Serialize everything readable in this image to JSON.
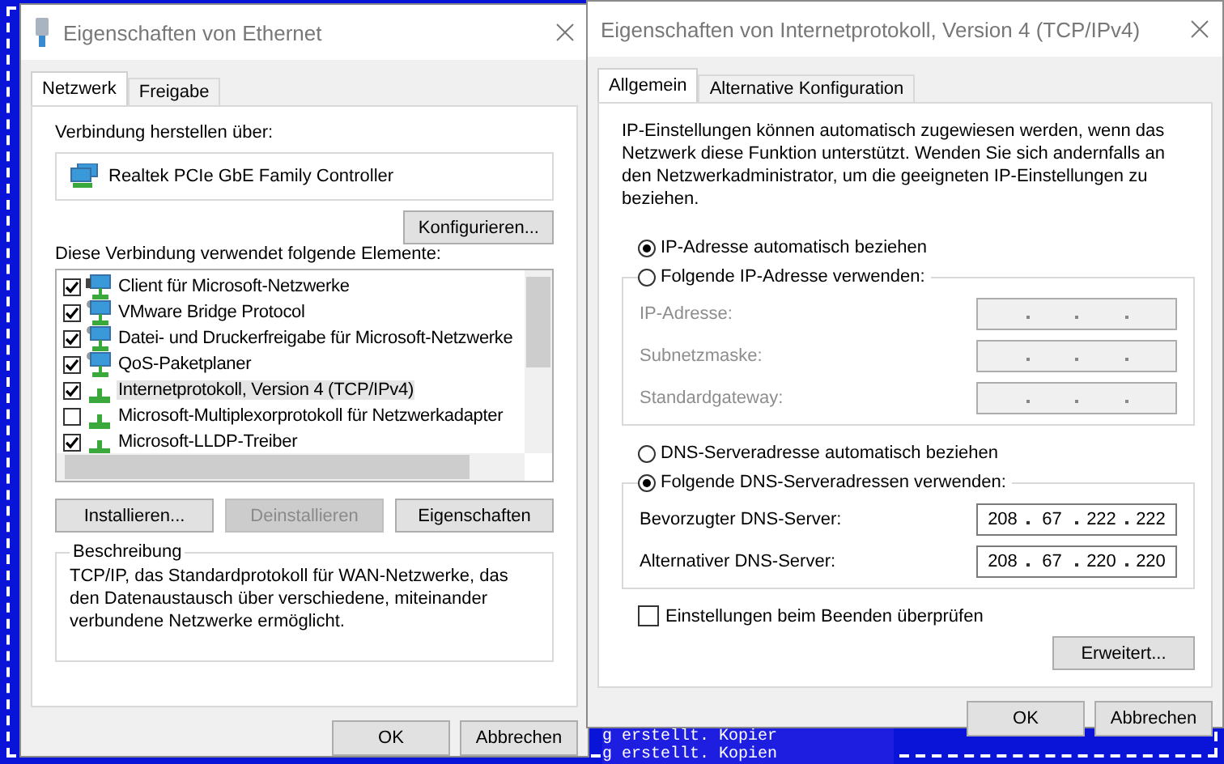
{
  "desktop": {
    "console_lines": [
      "g erstellt. Kopier",
      "g erstellt. Kopien"
    ]
  },
  "ethernet_dialog": {
    "title": "Eigenschaften von Ethernet",
    "tabs": [
      {
        "label": "Netzwerk",
        "selected": true
      },
      {
        "label": "Freigabe",
        "selected": false
      }
    ],
    "connect_label": "Verbindung herstellen über:",
    "adapter": "Realtek PCIe GbE Family Controller",
    "configure_button": "Konfigurieren...",
    "elements_label": "Diese Verbindung verwendet folgende Elemente:",
    "elements": [
      {
        "label": "Client für Microsoft-Netzwerke",
        "checked": true,
        "selected": false,
        "kind": "client"
      },
      {
        "label": "VMware Bridge Protocol",
        "checked": true,
        "selected": false,
        "kind": "service"
      },
      {
        "label": "Datei- und Druckerfreigabe für Microsoft-Netzwerke",
        "checked": true,
        "selected": false,
        "kind": "service"
      },
      {
        "label": "QoS-Paketplaner",
        "checked": true,
        "selected": false,
        "kind": "service"
      },
      {
        "label": "Internetprotokoll, Version 4 (TCP/IPv4)",
        "checked": true,
        "selected": true,
        "kind": "protocol"
      },
      {
        "label": "Microsoft-Multiplexorprotokoll für Netzwerkadapter",
        "checked": false,
        "selected": false,
        "kind": "protocol"
      },
      {
        "label": "Microsoft-LLDP-Treiber",
        "checked": true,
        "selected": false,
        "kind": "protocol"
      }
    ],
    "buttons": [
      {
        "label": "Installieren...",
        "disabled": false
      },
      {
        "label": "Deinstallieren",
        "disabled": true
      },
      {
        "label": "Eigenschaften",
        "disabled": false
      }
    ],
    "description": {
      "legend": "Beschreibung",
      "text": "TCP/IP, das Standardprotokoll für WAN-Netzwerke, das den Datenaustausch über verschiedene, miteinander verbundene Netzwerke ermöglicht."
    },
    "footer_buttons": [
      "OK",
      "Abbrechen"
    ]
  },
  "ipv4_dialog": {
    "title": "Eigenschaften von Internetprotokoll, Version 4 (TCP/IPv4)",
    "tabs": [
      {
        "label": "Allgemein",
        "selected": true
      },
      {
        "label": "Alternative Konfiguration",
        "selected": false
      }
    ],
    "intro": "IP-Einstellungen können automatisch zugewiesen werden, wenn das Netzwerk diese Funktion unterstützt. Wenden Sie sich andernfalls an den Netzwerkadministrator, um die geeigneten IP-Einstellungen zu beziehen.",
    "ip_auto": {
      "label": "IP-Adresse automatisch beziehen",
      "selected": true
    },
    "ip_manual": {
      "label": "Folgende IP-Adresse verwenden:",
      "selected": false
    },
    "ip_fields": [
      {
        "label": "IP-Adresse:",
        "disabled": true
      },
      {
        "label": "Subnetzmaske:",
        "disabled": true
      },
      {
        "label": "Standardgateway:",
        "disabled": true
      }
    ],
    "dns_auto": {
      "label": "DNS-Serveradresse automatisch beziehen",
      "selected": false
    },
    "dns_manual": {
      "label": "Folgende DNS-Serveradressen verwenden:",
      "selected": true
    },
    "dns_fields": [
      {
        "label": "Bevorzugter DNS-Server:",
        "disabled": false,
        "octets": [
          "208",
          "67",
          "222",
          "222"
        ]
      },
      {
        "label": "Alternativer DNS-Server:",
        "disabled": false,
        "octets": [
          "208",
          "67",
          "220",
          "220"
        ]
      }
    ],
    "validate": {
      "label": "Einstellungen beim Beenden überprüfen",
      "checked": false
    },
    "advanced_button": "Erweitert...",
    "footer_buttons": [
      "OK",
      "Abbrechen"
    ]
  }
}
